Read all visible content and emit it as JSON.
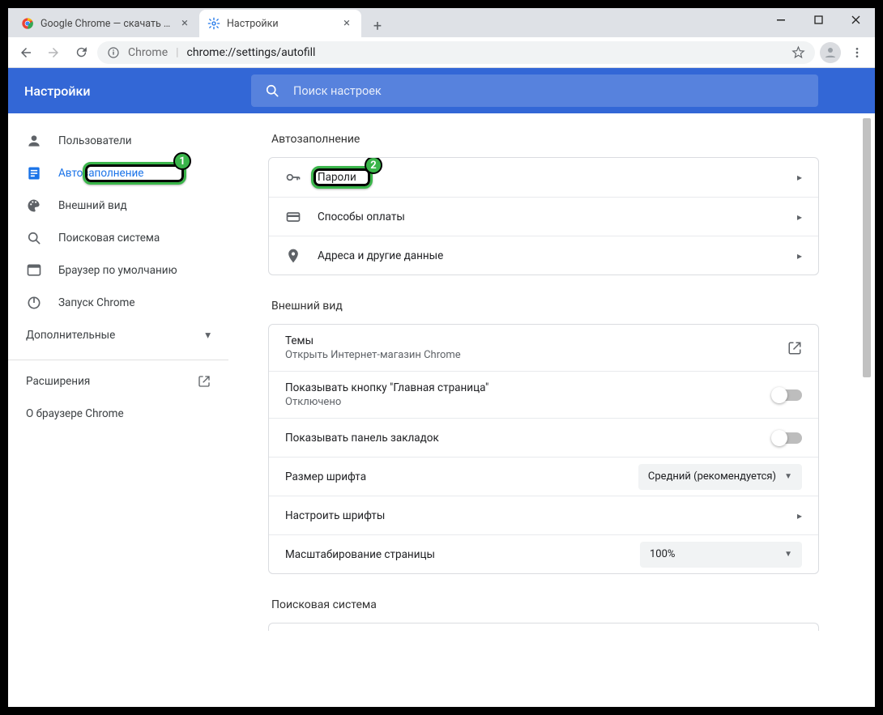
{
  "window": {
    "tabs": [
      {
        "title": "Google Chrome — скачать бесп",
        "active": false
      },
      {
        "title": "Настройки",
        "active": true
      }
    ],
    "omnibox": {
      "prefix": "Chrome",
      "url": "chrome://settings/autofill"
    }
  },
  "header": {
    "title": "Настройки",
    "search_placeholder": "Поиск настроек"
  },
  "sidebar": {
    "items": [
      {
        "label": "Пользователи",
        "icon": "person"
      },
      {
        "label": "Автозаполнение",
        "icon": "form",
        "active": true
      },
      {
        "label": "Внешний вид",
        "icon": "palette"
      },
      {
        "label": "Поисковая система",
        "icon": "search"
      },
      {
        "label": "Браузер по умолчанию",
        "icon": "browser"
      },
      {
        "label": "Запуск Chrome",
        "icon": "power"
      }
    ],
    "advanced": "Дополнительные",
    "extensions": "Расширения",
    "about": "О браузере Chrome"
  },
  "sections": {
    "autofill": {
      "title": "Автозаполнение",
      "rows": [
        {
          "icon": "key",
          "label": "Пароли"
        },
        {
          "icon": "card",
          "label": "Способы оплаты"
        },
        {
          "icon": "pin",
          "label": "Адреса и другие данные"
        }
      ]
    },
    "appearance": {
      "title": "Внешний вид",
      "themes": {
        "label": "Темы",
        "sub": "Открыть Интернет-магазин Chrome"
      },
      "home_button": {
        "label": "Показывать кнопку \"Главная страница\"",
        "sub": "Отключено"
      },
      "bookmarks_bar": {
        "label": "Показывать панель закладок"
      },
      "font_size": {
        "label": "Размер шрифта",
        "value": "Средний (рекомендуется)"
      },
      "customize_fonts": {
        "label": "Настроить шрифты"
      },
      "page_zoom": {
        "label": "Масштабирование страницы",
        "value": "100%"
      }
    },
    "search_engine": {
      "title": "Поисковая система"
    }
  },
  "annotations": {
    "badge1": "1",
    "badge2": "2"
  }
}
